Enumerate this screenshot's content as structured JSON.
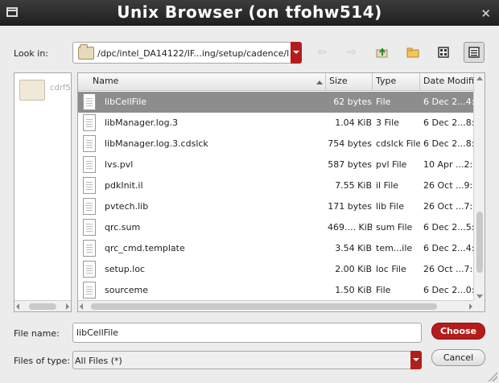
{
  "window": {
    "title": "Unix Browser (on tfohw514)",
    "close_glyph": "✕"
  },
  "look_in": {
    "label": "Look in:",
    "path": "/dpc/intel_DA14122/IF...ing/setup/cadence/ldk"
  },
  "toolbar": {
    "back_glyph": "⇦",
    "forward_glyph": "⇨",
    "icons": [
      "back-icon",
      "forward-icon",
      "parent-folder-icon",
      "new-folder-icon",
      "icon-view-icon",
      "list-view-icon"
    ]
  },
  "sidebar": {
    "items": [
      {
        "label": "cdrf5"
      }
    ]
  },
  "file_list": {
    "columns": [
      "Name",
      "Size",
      "Type",
      "Date Modified"
    ],
    "rows": [
      {
        "name": "libCellFile",
        "size": "62 bytes",
        "type": "File",
        "date": "6 Dec 2...4:0",
        "selected": true
      },
      {
        "name": "libManager.log.3",
        "size": "1.04 KiB",
        "type": "3 File",
        "date": "6 Dec 2...8:5"
      },
      {
        "name": "libManager.log.3.cdslck",
        "size": "754 bytes",
        "type": "cdslck File",
        "date": "6 Dec 2...8:5"
      },
      {
        "name": "lvs.pvl",
        "size": "587 bytes",
        "type": "pvl File",
        "date": "10 Apr ...2:5"
      },
      {
        "name": "pdkInit.il",
        "size": "7.55 KiB",
        "type": "il File",
        "date": "26 Oct ...9:3"
      },
      {
        "name": "pvtech.lib",
        "size": "171 bytes",
        "type": "lib File",
        "date": "26 Oct ...7:3"
      },
      {
        "name": "qrc.sum",
        "size": "469.... KiB",
        "type": "sum File",
        "date": "6 Dec 2...5:4"
      },
      {
        "name": "qrc_cmd.template",
        "size": "3.54 KiB",
        "type": "tem...ile",
        "date": "6 Dec 2...4:1"
      },
      {
        "name": "setup.loc",
        "size": "2.00 KiB",
        "type": "loc File",
        "date": "26 Oct ...7:3"
      },
      {
        "name": "sourceme",
        "size": "1.50 KiB",
        "type": "File",
        "date": "6 Dec 2...0:4"
      }
    ]
  },
  "file_name": {
    "label": "File name:",
    "value": "libCellFile"
  },
  "file_type": {
    "label": "Files of type:",
    "value": "All Files (*)"
  },
  "buttons": {
    "choose_label": "Choose",
    "cancel_label": "Cancel"
  },
  "colors": {
    "accent": "#b51c1c",
    "selection": "#8d8d8d",
    "titlebar": "#2a2a2a"
  }
}
